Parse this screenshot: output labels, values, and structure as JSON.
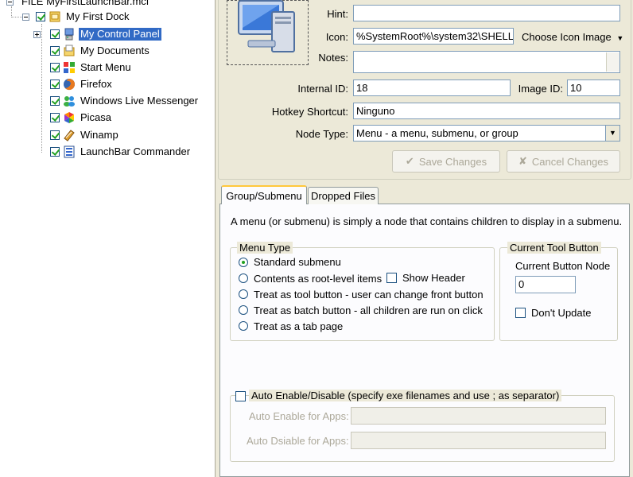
{
  "tree": {
    "root_label": "FILE MyFirstLaunchBar.mcf",
    "dock_label": "My First Dock",
    "items": [
      {
        "label": "My Control Panel",
        "icon": "control-panel-icon",
        "selected": true,
        "expandable": true
      },
      {
        "label": "My Documents",
        "icon": "documents-icon"
      },
      {
        "label": "Start Menu",
        "icon": "start-menu-icon"
      },
      {
        "label": "Firefox",
        "icon": "firefox-icon"
      },
      {
        "label": "Windows Live Messenger",
        "icon": "messenger-icon"
      },
      {
        "label": "Picasa",
        "icon": "picasa-icon"
      },
      {
        "label": "Winamp",
        "icon": "winamp-icon"
      },
      {
        "label": "LaunchBar Commander",
        "icon": "launchbar-icon"
      }
    ]
  },
  "props": {
    "hint_label": "Hint:",
    "hint_value": "",
    "icon_label": "Icon:",
    "icon_value": "%SystemRoot%\\system32\\SHELL:",
    "choose_icon_label": "Choose Icon Image",
    "notes_label": "Notes:",
    "notes_value": "",
    "internal_id_label": "Internal ID:",
    "internal_id_value": "18",
    "image_id_label": "Image ID:",
    "image_id_value": "10",
    "hotkey_label": "Hotkey Shortcut:",
    "hotkey_value": "Ninguno",
    "node_type_label": "Node Type:",
    "node_type_value": "Menu - a menu, submenu, or group",
    "save_label": "Save Changes",
    "cancel_label": "Cancel Changes"
  },
  "tabs": [
    {
      "label": "Group/Submenu",
      "active": true
    },
    {
      "label": "Dropped Files",
      "active": false
    }
  ],
  "group_tab": {
    "description": "A menu (or submenu) is simply a node that contains children to display in a submenu.",
    "menu_type_title": "Menu Type",
    "menu_types": [
      {
        "label": "Standard submenu",
        "selected": true
      },
      {
        "label": "Contents as root-level items",
        "selected": false
      },
      {
        "label": "Treat as tool button - user can change front button",
        "selected": false
      },
      {
        "label": "Treat as batch button - all children are run on click",
        "selected": false
      },
      {
        "label": "Treat as a tab page",
        "selected": false
      }
    ],
    "show_header_label": "Show Header",
    "current_tool_title": "Current Tool Button",
    "current_node_label": "Current Button Node",
    "current_node_value": "0",
    "dont_update_label": "Don't Update",
    "auto_title": "Auto Enable/Disable (specify exe filenames and use ; as separator)",
    "auto_enable_label": "Auto Enable for Apps:",
    "auto_disable_label": "Auto Dsiable for Apps:"
  },
  "colors": {
    "selection": "#316ac5",
    "window_bg": "#ece9d8",
    "check_green": "#21a121"
  }
}
